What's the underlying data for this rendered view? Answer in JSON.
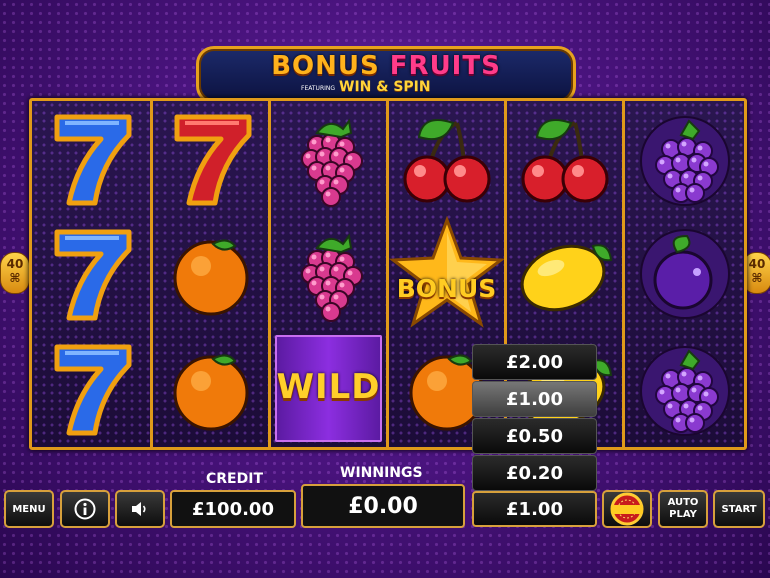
{
  "game": {
    "logo_word1": "BONUS",
    "logo_word2": "FRUITS",
    "logo_featuring": "FEATURING",
    "logo_subtitle": "WIN & SPIN"
  },
  "paylines": {
    "count": "40",
    "symbol": "⌘"
  },
  "reels": [
    [
      "blue-seven",
      "blue-seven",
      "blue-seven"
    ],
    [
      "red-seven",
      "orange",
      "orange"
    ],
    [
      "raspberry",
      "raspberry",
      "wild"
    ],
    [
      "cherry",
      "bonus-star",
      "orange"
    ],
    [
      "cherry",
      "lemon",
      "lemon"
    ],
    [
      "grapes",
      "plum",
      "grapes"
    ]
  ],
  "symbols": {
    "wild_label": "WILD",
    "bonus_label": "BONUS"
  },
  "controls": {
    "menu_label": "MENU",
    "info_icon": "info-icon",
    "sound_icon": "speaker-icon",
    "credit_label": "CREDIT",
    "credit_value": "£100.00",
    "winnings_label": "WINNINGS",
    "winnings_value": "£0.00",
    "stake_value": "£1.00",
    "fortune_spins_label": "FORTUNE SPINS",
    "autoplay_line1": "AUTO",
    "autoplay_line2": "PLAY",
    "start_label": "START"
  },
  "stake_options": [
    {
      "label": "£2.00",
      "selected": false
    },
    {
      "label": "£1.00",
      "selected": true
    },
    {
      "label": "£0.50",
      "selected": false
    },
    {
      "label": "£0.20",
      "selected": false
    }
  ],
  "colors": {
    "gold": "#e09a1a",
    "background": "#4b1480"
  }
}
